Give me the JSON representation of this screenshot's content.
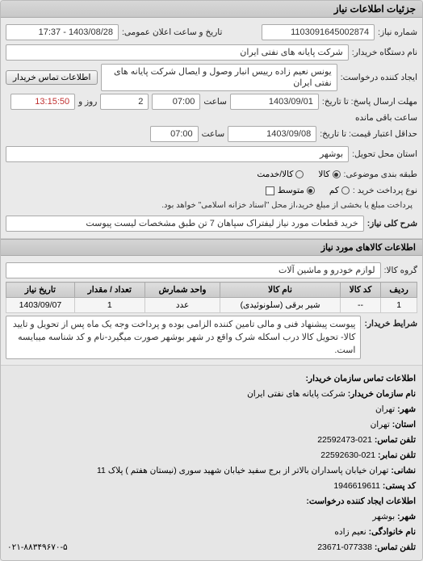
{
  "headerTitle": "جزئیات اطلاعات نیاز",
  "fields": {
    "requestNoLabel": "شماره نیاز:",
    "requestNo": "1103091645002874",
    "announceDateLabel": "تاریخ و ساعت اعلان عمومی:",
    "announceDate": "1403/08/28 - 17:37",
    "buyerDeviceLabel": "نام دستگاه خریدار:",
    "buyerDevice": "شرکت پایانه های نفتی ایران",
    "creatorLabel": "ایجاد کننده درخواست:",
    "creator": "یونس نعیم زاده رییس انبار وصول و ایصال شرکت پایانه های نفتی ایران",
    "contactBuyerBtn": "اطلاعات تماس خریدار",
    "deadlineSendLabel": "مهلت ارسال پاسخ: تا تاریخ:",
    "deadlineDate": "1403/09/01",
    "atLabel": "ساعت",
    "deadlineTime": "07:00",
    "dayLabel": "روز و",
    "daysLeft": "2",
    "timeLeft": "13:15:50",
    "remainLabel": "ساعت باقی مانده",
    "validUntilLabel": "حداقل اعتبار قیمت: تا تاریخ:",
    "validDate": "1403/09/08",
    "validTime": "07:00",
    "deliveryPlaceLabel": "استان محل تحویل:",
    "deliveryPlace": "بوشهر",
    "classifyLabel": "طبقه بندی موضوعی:",
    "optKala": "کالا",
    "optKhadamat": "کالا/خدمت",
    "purchaseTypeLabel": "نوع پرداخت خرید :",
    "optLow": "کم",
    "optMed": "متوسط",
    "paymentNote": "پرداخت مبلغ یا بخشی از مبلغ خرید،از محل \"اسناد خزانه اسلامی\" خواهد بود.",
    "descTitleLabel": "شرح کلی نیاز:",
    "descTitle": "خرید قطعات مورد نیاز لیفتراک سپاهان 7 تن طبق مشخصات لیست پیوست"
  },
  "itemsSection": {
    "title": "اطلاعات کالاهای مورد نیاز",
    "groupLabel": "گروه کالا:",
    "group": "لوازم خودرو و ماشین آلات",
    "columns": {
      "row": "ردیف",
      "code": "کد کالا",
      "name": "نام کالا",
      "unit": "واحد شمارش",
      "qty": "تعداد / مقدار",
      "date": "تاریخ نیاز"
    },
    "rows": [
      {
        "row": "1",
        "code": "--",
        "name": "شیر برقی (سلونوئیدی)",
        "unit": "عدد",
        "qty": "1",
        "date": "1403/09/07"
      }
    ],
    "conditionsLabel": "شرایط خریدار:",
    "conditions": "پیوست پیشنهاد فنی و مالی تامین کننده الزامی بوده و پرداخت وجه یک ماه پس از تحویل و تایید کالا- تحویل کالا درب اسکله شرک واقع در شهر بوشهر صورت میگیرد-نام و کد شناسه میبایسه است."
  },
  "contact": {
    "title": "اطلاعات تماس سازمان خریدار:",
    "orgLabel": "نام سازمان خریدار:",
    "org": "شرکت پایانه های نفتی ایران",
    "cityLabel": "شهر:",
    "city": "تهران",
    "provLabel": "استان:",
    "prov": "تهران",
    "phoneLabel": "تلفن تماس:",
    "phone": "021-22592473",
    "faxLabel": "تلفن نمابر:",
    "fax": "021-22592630",
    "addressLabel": "نشانی:",
    "address": "تهران خیابان پاسداران بالاتر از برج سفید خیابان شهید سورى (نیستان هفتم ) پلاک 11",
    "postalLabel": "کد پستی:",
    "postal": "1946619611",
    "creatorTitle": "اطلاعات ایجاد کننده درخواست:",
    "creatorCityLabel": "شهر:",
    "creatorCity": "بوشهر",
    "familyLabel": "نام خانوادگی:",
    "family": "نعیم زاده",
    "creatorPhoneLabel": "تلفن تماس:",
    "creatorPhone": "077338-23671",
    "corner": "۰۲۱-۸۸۳۴۹۶۷۰-۵"
  }
}
